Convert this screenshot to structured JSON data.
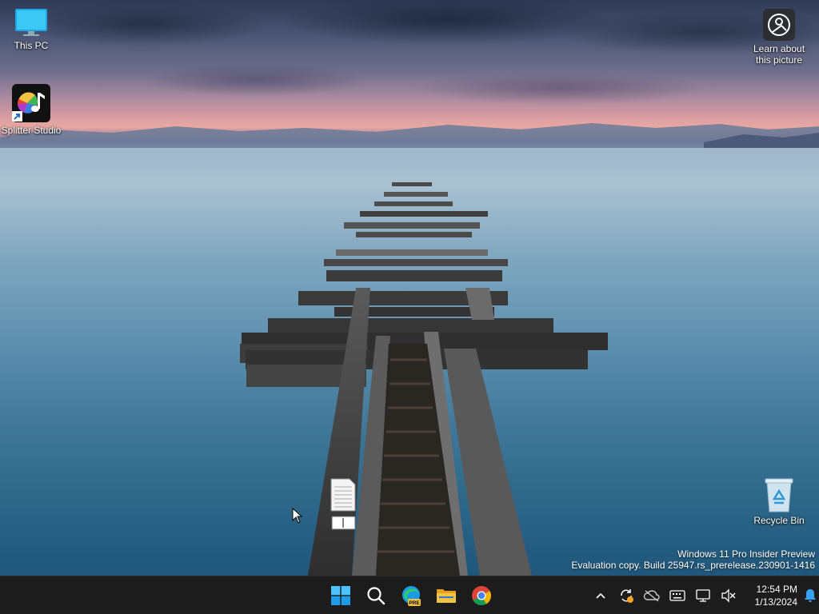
{
  "desktop": {
    "icons": [
      {
        "label": "This PC",
        "icon": "this-pc-icon"
      },
      {
        "label": "Splitter Studio",
        "icon": "splitter-studio-icon"
      },
      {
        "label": "Learn about this picture",
        "icon": "learn-about-picture-icon"
      },
      {
        "label": "Recycle Bin",
        "icon": "recycle-bin-icon"
      }
    ],
    "watermark": {
      "line1": "Windows 11 Pro Insider Preview",
      "line2": "Evaluation copy. Build 25947.rs_prerelease.230901-1416"
    }
  },
  "taskbar": {
    "apps": [
      {
        "name": "Start",
        "icon": "windows-start-icon"
      },
      {
        "name": "Search",
        "icon": "search-icon"
      },
      {
        "name": "Microsoft Edge Preview",
        "icon": "edge-pre-icon",
        "badge": "PRE"
      },
      {
        "name": "File Explorer",
        "icon": "folder-icon"
      },
      {
        "name": "Google Chrome",
        "icon": "chrome-icon"
      }
    ],
    "tray": [
      "chevron-up-icon",
      "sync-icon",
      "onedrive-off-icon",
      "keyboard-icon",
      "network-icon",
      "volume-muted-icon"
    ],
    "clock": {
      "time": "12:54 PM",
      "date": "1/13/2024"
    },
    "notifications_icon": "bell-icon"
  },
  "colors": {
    "taskbar": "#1c1c1c",
    "accent": "#0078d4",
    "edge": "#1c9be6",
    "folder": "#f5c342",
    "bell": "#3aa0f0"
  }
}
